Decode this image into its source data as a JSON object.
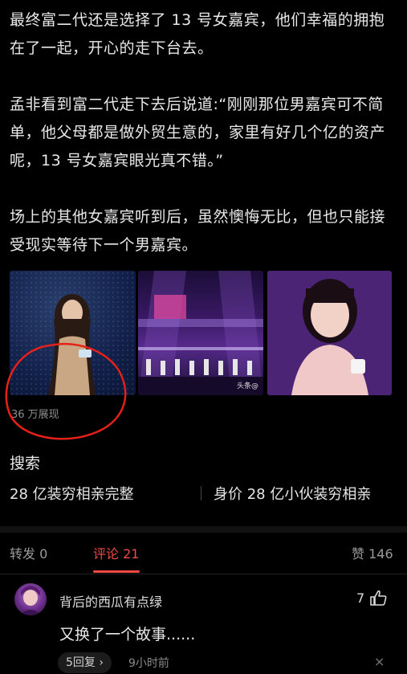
{
  "article": {
    "paragraphs": [
      "最终富二代还是选择了 13 号女嘉宾，他们幸福的拥抱在了一起，开心的走下台去。",
      "孟非看到富二代走下去后说道:“刚刚那位男嘉宾可不简单，他父母都是做外贸生意的，家里有好几个亿的资产呢，13 号女嘉宾眼光真不错。”",
      "场上的其他女嘉宾听到后，虽然懊悔无比，但也只能接受现实等待下一个男嘉宾。"
    ],
    "images": [
      {
        "alt": "女嘉宾照片"
      },
      {
        "alt": "舞台节目画面",
        "watermark": "头条@"
      },
      {
        "alt": "女嘉宾特写"
      }
    ],
    "views_label": "36 万展现"
  },
  "search": {
    "title": "搜索",
    "items": [
      "28 亿装穷相亲完整",
      "身价 28 亿小伙装穷相亲"
    ]
  },
  "tabs": {
    "repost": "转发 0",
    "comments": "评论 21",
    "likes": "赞 146"
  },
  "comment": {
    "username": "背后的西瓜有点绿",
    "likes": "7",
    "text": "又换了一个故事......",
    "reply_label": "5回复 ›",
    "time": "9小时前",
    "close": "×"
  },
  "colors": {
    "accent": "#f04a45",
    "annotation": "#e8201a",
    "background": "#000000"
  }
}
